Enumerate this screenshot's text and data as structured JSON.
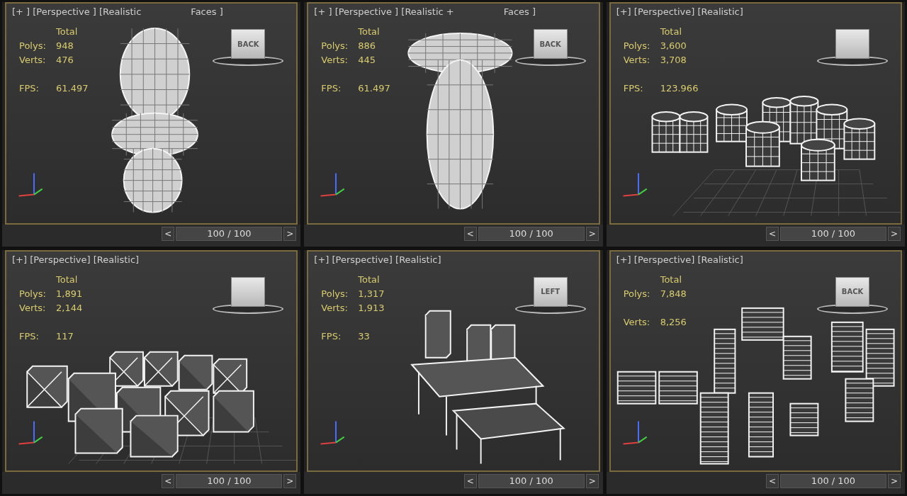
{
  "viewports": [
    {
      "labels": [
        "[+ ] [Perspective ] [Realistic",
        "Faces ]"
      ],
      "heading": "Total",
      "stats": [
        {
          "label": "Polys:",
          "value": "948"
        },
        {
          "label": "Verts:",
          "value": "476"
        },
        {
          "label": "FPS:",
          "value": "61.497"
        }
      ],
      "viewcube": "BACK",
      "kind": "bust",
      "prev": "<",
      "time": "100 / 100",
      "level": 1,
      "next": ">"
    },
    {
      "labels": [
        "[+ ] [Perspective ] [Realistic +",
        "Faces ]"
      ],
      "heading": "Total",
      "stats": [
        {
          "label": "Polys:",
          "value": "886"
        },
        {
          "label": "Verts:",
          "value": "445"
        },
        {
          "label": "FPS:",
          "value": "61.497"
        }
      ],
      "viewcube": "BACK",
      "kind": "figure",
      "prev": "<",
      "time": "100 / 100",
      "level": 1,
      "next": ">"
    },
    {
      "labels": [
        "[+] [Perspective] [Realistic]"
      ],
      "heading": "Total",
      "stats": [
        {
          "label": "Polys:",
          "value": "3,600"
        },
        {
          "label": "Verts:",
          "value": "3,708"
        },
        {
          "label": "FPS:",
          "value": "123.966"
        }
      ],
      "kind": "barrels",
      "prev": "<",
      "time": "100 / 100",
      "level": 1,
      "next": ">"
    },
    {
      "labels": [
        "[+] [Perspective] [Realistic]"
      ],
      "heading": "Total",
      "stats": [
        {
          "label": "Polys:",
          "value": "1,891"
        },
        {
          "label": "Verts:",
          "value": "2,144"
        },
        {
          "label": "FPS:",
          "value": "117"
        }
      ],
      "kind": "crates",
      "prev": "<",
      "time": "100 / 100",
      "level": 1,
      "next": ">"
    },
    {
      "labels": [
        "[+] [Perspective] [Realistic]"
      ],
      "heading": "Total",
      "stats": [
        {
          "label": "Polys:",
          "value": "1,317"
        },
        {
          "label": "Verts:",
          "value": "1,913"
        },
        {
          "label": "FPS:",
          "value": "33"
        }
      ],
      "viewcube": "LEFT",
      "kind": "buildings",
      "prev": "<",
      "time": "100 / 100",
      "level": 1,
      "next": ">"
    },
    {
      "labels": [
        "[+] [Perspective] [Realistic]"
      ],
      "heading": "Total",
      "stats": [
        {
          "label": "Polys:",
          "value": "7,848"
        },
        {
          "label": "Verts:",
          "value": "8,256"
        }
      ],
      "viewcube": "BACK",
      "kind": "pallets",
      "prev": "<",
      "time": "100 / 100",
      "level": 1,
      "next": ">"
    }
  ]
}
